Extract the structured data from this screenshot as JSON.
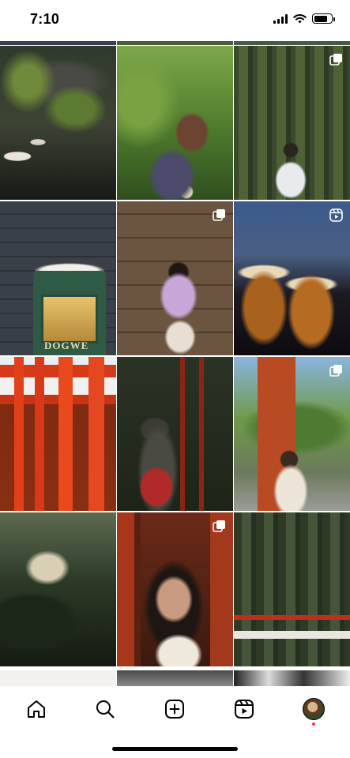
{
  "status_bar": {
    "time": "7:10",
    "battery_level": 0.8
  },
  "grid": {
    "tiles": [
      {
        "subject": "ferns-and-mushrooms-forest",
        "badge": "none"
      },
      {
        "subject": "girl-in-greenery-with-drink",
        "badge": "none"
      },
      {
        "subject": "person-on-bamboo-forest-bridge",
        "badge": "carousel"
      },
      {
        "subject": "stone-wall-shop-window",
        "badge": "none",
        "sign_text": "DOGWE"
      },
      {
        "subject": "girl-with-drink-against-stone-wall",
        "badge": "carousel"
      },
      {
        "subject": "butterbeer-mugs-toast",
        "badge": "reel"
      },
      {
        "subject": "red-torii-gates",
        "badge": "none"
      },
      {
        "subject": "fox-statue-with-red-bib",
        "badge": "none"
      },
      {
        "subject": "girl-near-pagoda",
        "badge": "carousel"
      },
      {
        "subject": "dark-garden-lantern",
        "badge": "none"
      },
      {
        "subject": "portrait-in-torii-tunnel",
        "badge": "carousel"
      },
      {
        "subject": "torii-gates-in-forest",
        "badge": "none"
      }
    ]
  },
  "tab_bar": {
    "items": [
      {
        "icon": "home-icon"
      },
      {
        "icon": "search-icon"
      },
      {
        "icon": "create-post-icon"
      },
      {
        "icon": "reels-icon"
      },
      {
        "icon": "profile-avatar"
      }
    ],
    "notification_dot_color": "#ff3040"
  }
}
